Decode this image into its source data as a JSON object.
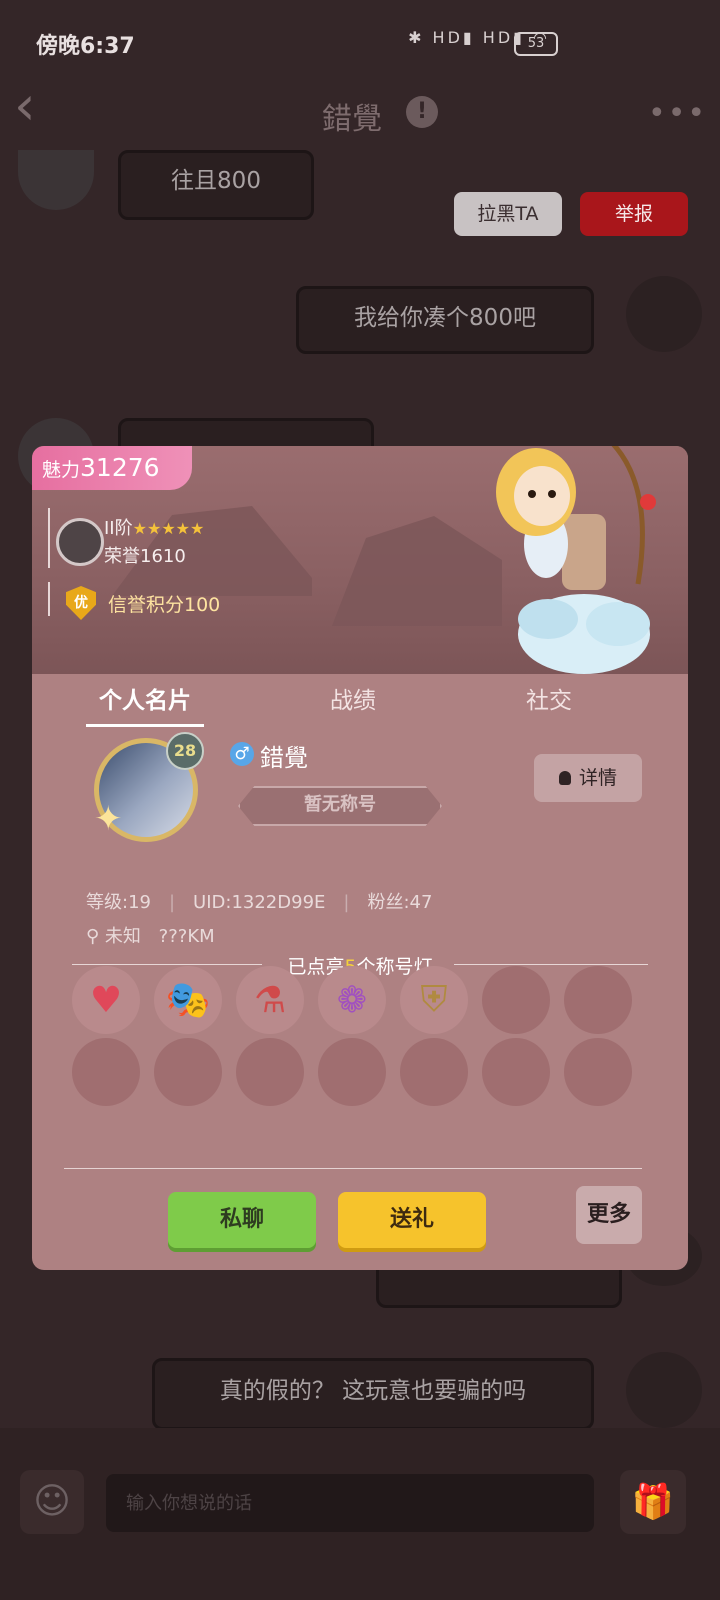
{
  "status_bar": {
    "time": "傍晚6:37",
    "icons": "✱ HD▮ HD▮ ◠",
    "battery": "53"
  },
  "top_bar": {
    "back_icon": "back-chevron-icon",
    "title": "錯覺",
    "info_icon": "info-icon",
    "more_icon": "more-dots-icon"
  },
  "chat": {
    "messages": [
      {
        "side": "left",
        "text": "往且800"
      },
      {
        "side": "right",
        "text": "我给你凑个800吧"
      },
      {
        "side": "right",
        "text": "真的假的？ 这玩意也要骗的吗"
      }
    ],
    "block_label": "拉黑TA",
    "report_label": "举报"
  },
  "card": {
    "charm_label": "魅力",
    "charm_value": "31276",
    "rank": "II阶",
    "rank_stars": "★★★★★",
    "honor_label": "荣誉",
    "honor_value": "1610",
    "credit_badge": "优",
    "credit_text": "信誉积分100",
    "tabs": [
      "个人名片",
      "战绩",
      "社交"
    ],
    "level": "28",
    "gender_icon": "male-icon",
    "nickname": "錯覺",
    "title_plate": "暂无称号",
    "detail_label": "详情",
    "meta": {
      "level": "等级:19",
      "uid": "UID:1322D99E",
      "fans": "粉丝:47"
    },
    "location": "未知",
    "distance": "???KM",
    "lights": {
      "prefix": "已点亮",
      "count": "5",
      "suffix": "个称号灯"
    },
    "badges": [
      {
        "name": "heart-gem-icon",
        "glyph": "♥",
        "color": "#e0485a"
      },
      {
        "name": "masks-icon",
        "glyph": "🎭",
        "color": "#7a5ac8"
      },
      {
        "name": "potions-icon",
        "glyph": "⚗",
        "color": "#d04a4a"
      },
      {
        "name": "flower-crest-icon",
        "glyph": "❁",
        "color": "#a050c0"
      },
      {
        "name": "shield-sword-icon",
        "glyph": "⛨",
        "color": "#b08a40"
      }
    ],
    "chat_button": "私聊",
    "gift_button": "送礼",
    "more_button": "更多"
  },
  "input": {
    "placeholder": "输入你想说的话",
    "emoji_icon": "emoji-icon",
    "gift_icon": "gift-box-icon"
  }
}
